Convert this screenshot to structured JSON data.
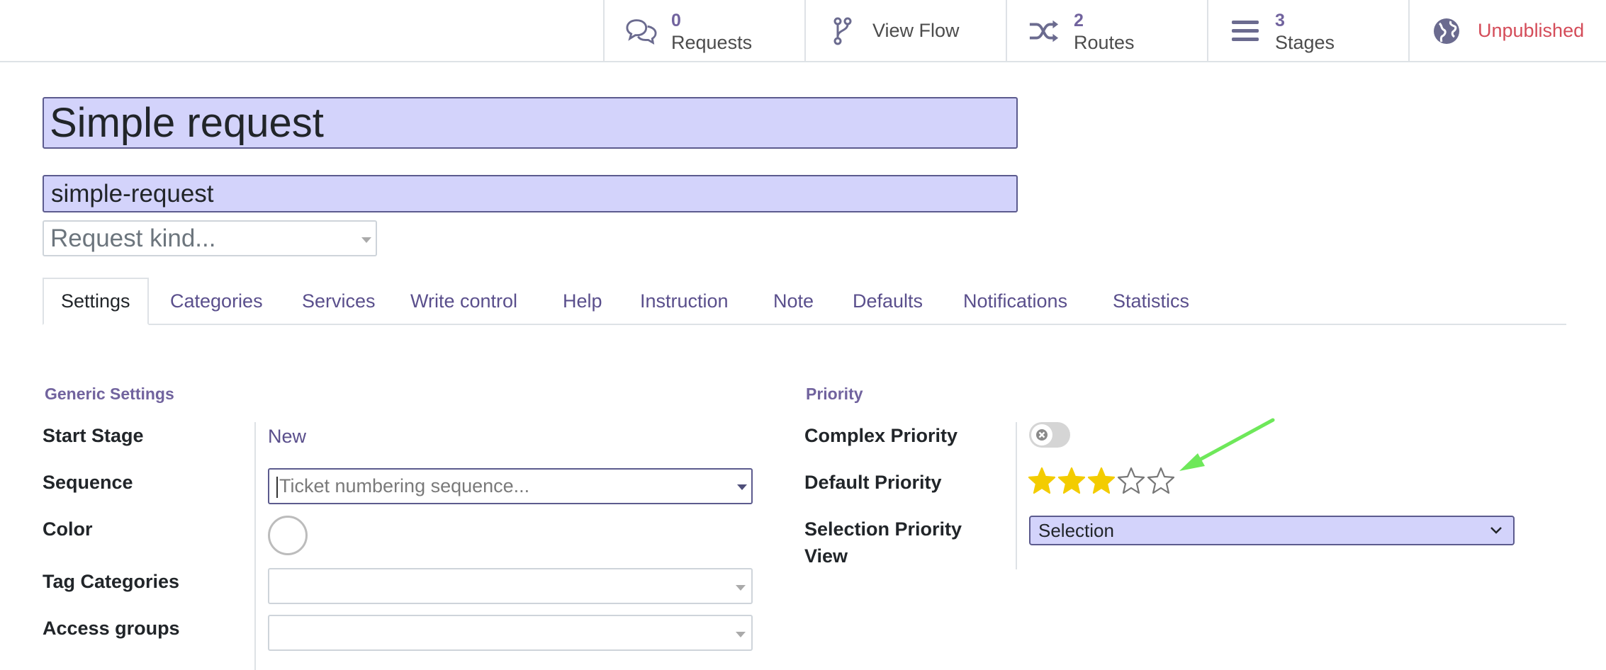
{
  "topbar": {
    "requests": {
      "count": "0",
      "label": "Requests",
      "icon": "chat-bubbles-icon"
    },
    "view_flow": {
      "label": "View Flow",
      "icon": "branch-icon"
    },
    "routes": {
      "count": "2",
      "label": "Routes",
      "icon": "shuffle-icon"
    },
    "stages": {
      "count": "3",
      "label": "Stages",
      "icon": "list-icon"
    },
    "publish": {
      "label": "Unpublished",
      "icon": "globe-icon",
      "color": "#d44c59"
    }
  },
  "form": {
    "name": "Simple request",
    "code": "simple-request",
    "kind_placeholder": "Request kind..."
  },
  "tabs": [
    "Settings",
    "Categories",
    "Services",
    "Write control",
    "Help",
    "Instruction",
    "Note",
    "Defaults",
    "Notifications",
    "Statistics"
  ],
  "generic": {
    "title": "Generic Settings",
    "start_stage_label": "Start Stage",
    "start_stage_value": "New",
    "sequence_label": "Sequence",
    "sequence_placeholder": "Ticket numbering sequence...",
    "color_label": "Color",
    "tag_categories_label": "Tag Categories",
    "access_groups_label": "Access groups"
  },
  "priority": {
    "title": "Priority",
    "complex_label": "Complex Priority",
    "complex_enabled": false,
    "default_label": "Default Priority",
    "default_stars": 3,
    "max_stars": 5,
    "selection_view_label_line1": "Selection Priority",
    "selection_view_label_line2": "View",
    "selection_view_value": "Selection"
  },
  "colors": {
    "accent": "#71639e",
    "field_bg": "#d3d3fb",
    "star_filled": "#f3cc00",
    "annotation_arrow": "#6ee85a"
  }
}
